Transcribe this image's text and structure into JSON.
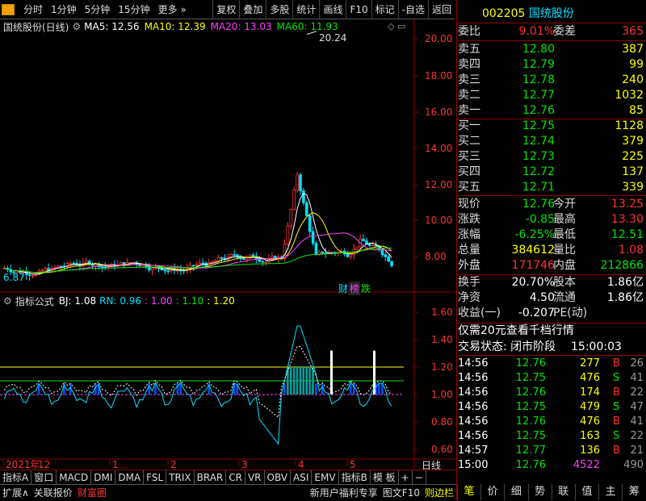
{
  "toolbar": {
    "left": [
      "分时",
      "1分钟",
      "5分钟",
      "15分钟",
      "更多"
    ],
    "right": [
      "复权",
      "叠加",
      "多股",
      "统计",
      "画线",
      "F10",
      "标记",
      "-自选",
      "返回"
    ]
  },
  "chart": {
    "title": "国统股份(日线)",
    "ma": [
      {
        "label": "MA5: 12.56",
        "color": "#ffffff"
      },
      {
        "label": "MA10: 12.39",
        "color": "#ffff00"
      },
      {
        "label": "MA20: 13.03",
        "color": "#ff40ff"
      },
      {
        "label": "MA60: 11.93",
        "color": "#00e600"
      }
    ],
    "high_label": "20.24",
    "low_label": "6.87",
    "yticks": [
      "20.00",
      "18.00",
      "16.00",
      "14.00",
      "12.00",
      "10.00",
      "8.00"
    ],
    "badges": [
      "财",
      "榜",
      "跌"
    ],
    "date_axis": [
      "2021年",
      "12",
      "1",
      "2",
      "3",
      "4",
      "5"
    ],
    "period": "日线"
  },
  "indicator": {
    "title": "指标公式",
    "values": [
      {
        "label": "BJ: 1.08",
        "color": "#ffffff"
      },
      {
        "label": "RN: 0.96",
        "color": "#00e0ff"
      },
      {
        "label": ": 1.00",
        "color": "#ff40ff"
      },
      {
        "label": ": 1.10",
        "color": "#00e600"
      },
      {
        "label": ": 1.20",
        "color": "#ffff00"
      }
    ],
    "yticks": [
      "1.60",
      "1.40",
      "1.20",
      "1.00",
      "0.80",
      "0.60"
    ]
  },
  "tabs": [
    "指标A",
    "窗口",
    "MACD",
    "DMI",
    "DMA",
    "FSL",
    "TRIX",
    "BRAR",
    "CR",
    "VR",
    "OBV",
    "ASI",
    "EMV",
    "指标B",
    "模 板",
    "+",
    "−"
  ],
  "bottombar": [
    "扩展∧",
    "关联报价",
    "财富圈",
    "新用户福利专享",
    "图文F10",
    "则边栏"
  ],
  "stock": {
    "code": "002205",
    "name": "国统股份"
  },
  "weibi": {
    "l1": "委比",
    "v1": "9.01%",
    "l2": "委差",
    "v2": "365"
  },
  "sell": [
    {
      "label": "卖五",
      "price": "12.80",
      "vol": "387"
    },
    {
      "label": "卖四",
      "price": "12.79",
      "vol": "99"
    },
    {
      "label": "卖三",
      "price": "12.78",
      "vol": "240"
    },
    {
      "label": "卖二",
      "price": "12.77",
      "vol": "1032"
    },
    {
      "label": "卖一",
      "price": "12.76",
      "vol": "85"
    }
  ],
  "buy": [
    {
      "label": "买一",
      "price": "12.75",
      "vol": "1128"
    },
    {
      "label": "买二",
      "price": "12.74",
      "vol": "379"
    },
    {
      "label": "买三",
      "price": "12.73",
      "vol": "225"
    },
    {
      "label": "买四",
      "price": "12.72",
      "vol": "137"
    },
    {
      "label": "买五",
      "price": "12.71",
      "vol": "339"
    }
  ],
  "quote": [
    {
      "l1": "现价",
      "v1": "12.76",
      "c1": "grn",
      "l2": "今开",
      "v2": "13.25",
      "c2": "red"
    },
    {
      "l1": "涨跌",
      "v1": "-0.85",
      "c1": "grn",
      "l2": "最高",
      "v2": "13.30",
      "c2": "red"
    },
    {
      "l1": "涨幅",
      "v1": "-6.25%",
      "c1": "grn",
      "l2": "最低",
      "v2": "12.51",
      "c2": "grn"
    },
    {
      "l1": "总量",
      "v1": "384612",
      "c1": "yel",
      "l2": "量比",
      "v2": "1.08",
      "c2": "red"
    },
    {
      "l1": "外盘",
      "v1": "171746",
      "c1": "red",
      "l2": "内盘",
      "v2": "212866",
      "c2": "grn"
    }
  ],
  "stats": [
    {
      "l1": "换手",
      "v1": "20.70%",
      "l2": "股本",
      "v2": "1.86亿"
    },
    {
      "l1": "净资",
      "v1": "4.50",
      "l2": "流通",
      "v2": "1.86亿"
    },
    {
      "l1": "收益(一)",
      "v1": "-0.207",
      "l2": "PE(动)",
      "v2": ""
    }
  ],
  "promo": "仅需20元查看千档行情",
  "trade_status": {
    "label": "交易状态: 闭市阶段",
    "time": "15:00:03"
  },
  "trades": [
    {
      "t": "14:56",
      "p": "12.76",
      "v": "277",
      "s": "B",
      "n": "26"
    },
    {
      "t": "14:56",
      "p": "12.75",
      "v": "476",
      "s": "S",
      "n": "41"
    },
    {
      "t": "14:56",
      "p": "12.76",
      "v": "174",
      "s": "B",
      "n": "22"
    },
    {
      "t": "14:56",
      "p": "12.75",
      "v": "479",
      "s": "S",
      "n": "47"
    },
    {
      "t": "14:56",
      "p": "12.76",
      "v": "476",
      "s": "B",
      "n": "41"
    },
    {
      "t": "14:56",
      "p": "12.75",
      "v": "163",
      "s": "S",
      "n": "22"
    },
    {
      "t": "14:57",
      "p": "12.77",
      "v": "136",
      "s": "B",
      "n": "21"
    },
    {
      "t": "15:00",
      "p": "12.76",
      "v": "4522",
      "s": "",
      "n": "490"
    }
  ],
  "nav": [
    "笔",
    "价",
    "细",
    "势",
    "联",
    "值",
    "主",
    "筹"
  ]
}
